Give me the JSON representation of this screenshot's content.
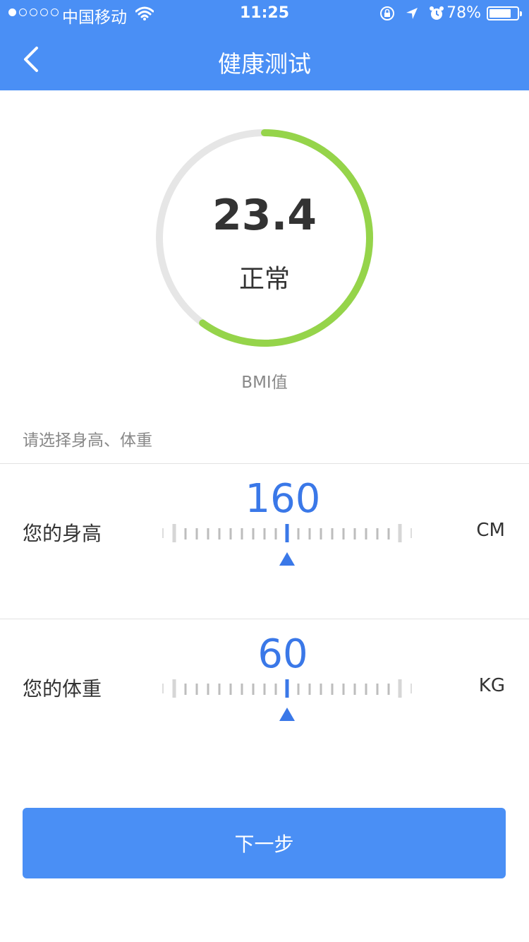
{
  "status_bar": {
    "carrier": "中国移动",
    "time": "11:25",
    "battery_percent": "78%",
    "battery_level": 0.78,
    "signal_bars_filled": 1,
    "signal_bars_total": 5
  },
  "nav": {
    "title": "健康测试",
    "back_icon": "chevron-left-icon"
  },
  "bmi": {
    "value": "23.4",
    "status": "正常",
    "label": "BMI值",
    "gauge_fraction": 0.6
  },
  "prompt": "请选择身高、体重",
  "height": {
    "label": "您的身高",
    "value": "160",
    "unit": "CM"
  },
  "weight": {
    "label": "您的体重",
    "value": "60",
    "unit": "KG"
  },
  "next_button": "下一步",
  "colors": {
    "primary": "#4a8ff5",
    "accent_blue": "#3a78e8",
    "gauge_green": "#95d44a",
    "gauge_track": "#e6e6e6",
    "tick_gray": "#c8c8c8"
  }
}
